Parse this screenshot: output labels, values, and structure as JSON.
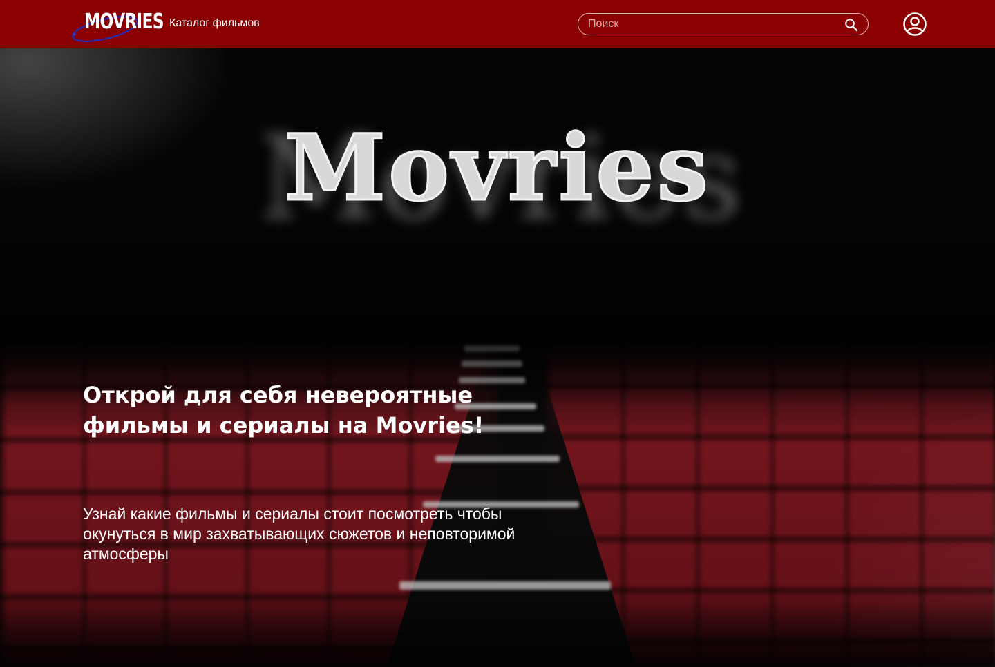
{
  "header": {
    "logo_text": "MOVRIES",
    "nav_catalog": "Каталог фильмов",
    "search_placeholder": "Поиск",
    "search_icon": "search-icon",
    "profile_icon": "user-circle-icon",
    "colors": {
      "background": "#8b0000"
    }
  },
  "hero": {
    "brand": "Movries",
    "headline": "Открой для себя невероятные фильмы и сериалы на Movries!",
    "subtitle": "Узнай какие фильмы и сериалы стоит посмотреть чтобы окунуться в мир захватывающих сюжетов и неповторимой атмосферы"
  }
}
